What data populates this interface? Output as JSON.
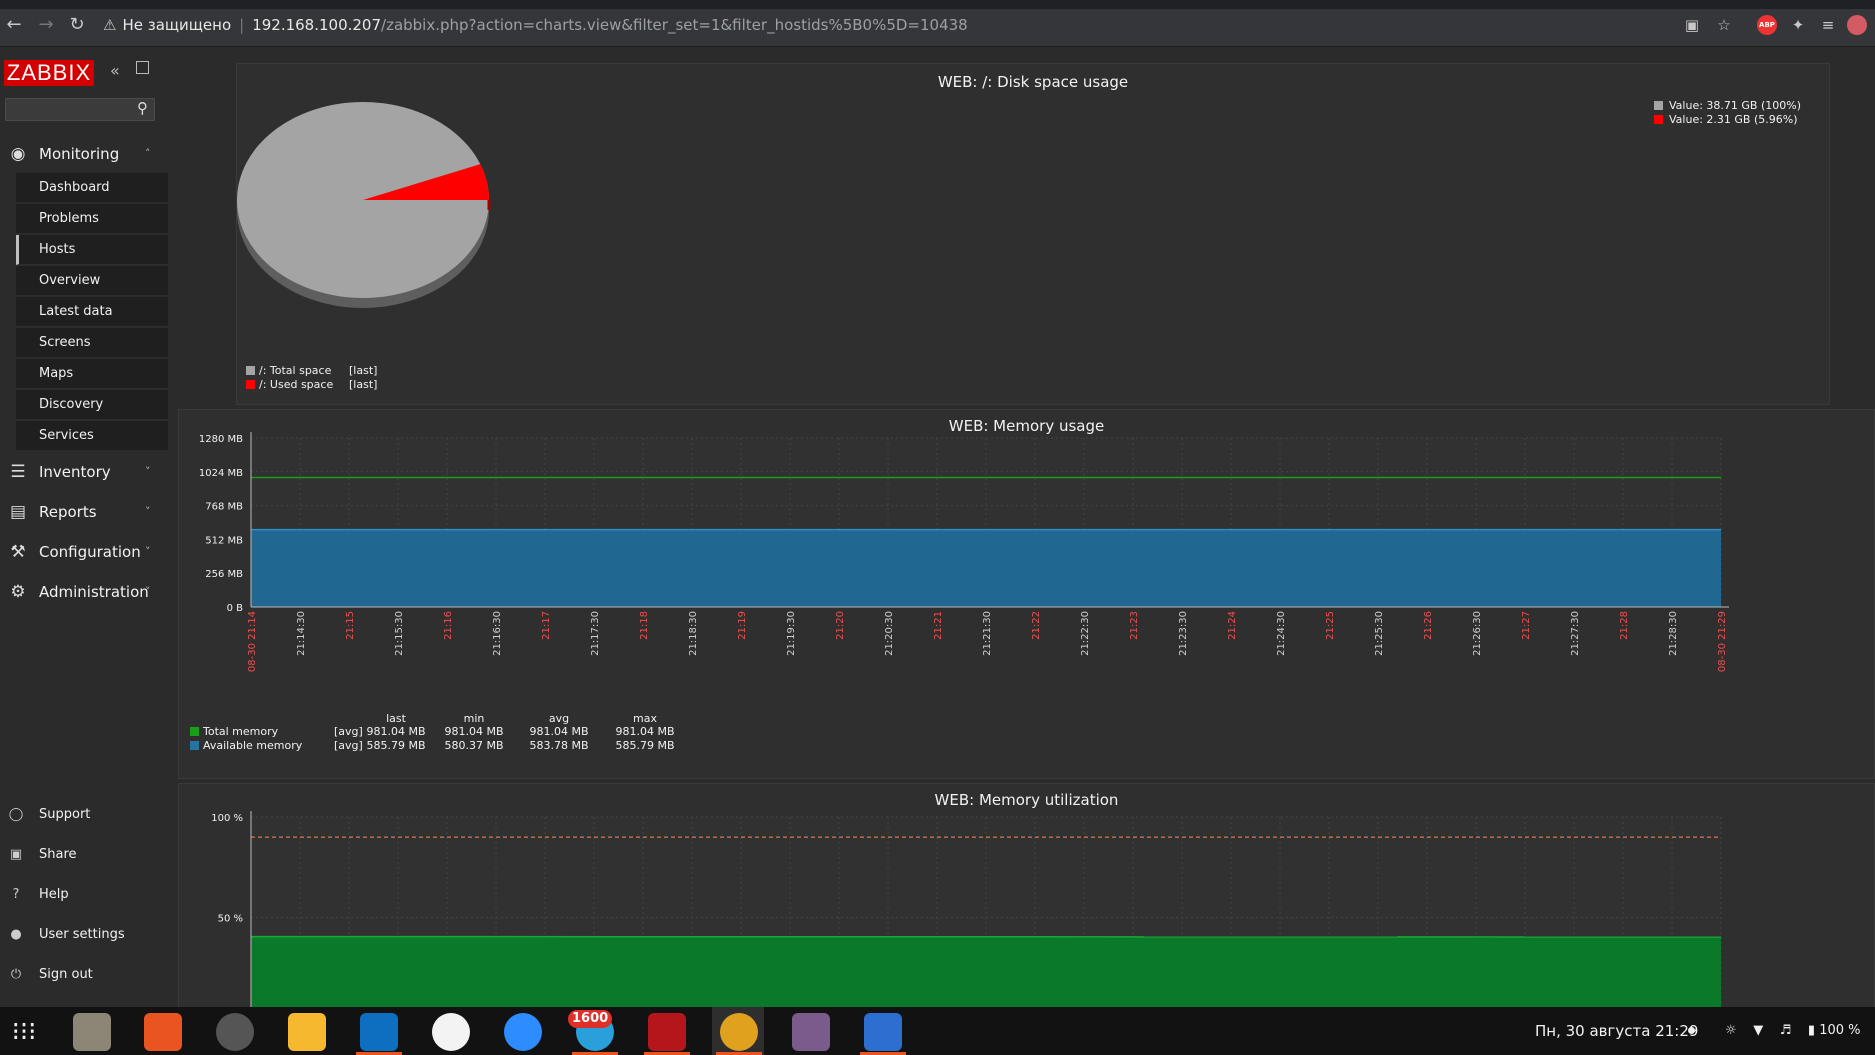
{
  "browser": {
    "security_label": "Не защищено",
    "url_host": "192.168.100.207",
    "url_path": "/zabbix.php?action=charts.view&filter_set=1&filter_hostids%5B0%5D=10438",
    "adblock_label": "ABP"
  },
  "sidebar": {
    "logo": "ZABBIX",
    "sections": [
      {
        "label": "Monitoring",
        "icon": "eye-icon",
        "expanded": true
      },
      {
        "label": "Inventory",
        "icon": "list-icon"
      },
      {
        "label": "Reports",
        "icon": "bar-chart-icon"
      },
      {
        "label": "Configuration",
        "icon": "wrench-icon"
      },
      {
        "label": "Administration",
        "icon": "gear-icon"
      }
    ],
    "monitoring_items": [
      "Dashboard",
      "Problems",
      "Hosts",
      "Overview",
      "Latest data",
      "Screens",
      "Maps",
      "Discovery",
      "Services"
    ],
    "active_item": "Hosts",
    "footer": [
      "Support",
      "Share",
      "Help",
      "User settings",
      "Sign out"
    ]
  },
  "graphs": {
    "disk": {
      "title": "WEB: /: Disk space usage",
      "values": [
        "Value: 38.71 GB (100%)",
        "Value: 2.31 GB (5.96%)"
      ],
      "items": [
        {
          "name": "/: Total space",
          "func": "[last]",
          "color": "#a4a4a4"
        },
        {
          "name": "/: Used space",
          "func": "[last]",
          "color": "#ff0000"
        }
      ]
    },
    "memory": {
      "title": "WEB: Memory usage",
      "headers": [
        "last",
        "min",
        "avg",
        "max"
      ],
      "rows": [
        {
          "name": "Total memory",
          "func": "[avg]",
          "last": "981.04 MB",
          "min": "981.04 MB",
          "avg": "981.04 MB",
          "max": "981.04 MB",
          "color": "#1a9f1a"
        },
        {
          "name": "Available memory",
          "func": "[avg]",
          "last": "585.79 MB",
          "min": "580.37 MB",
          "avg": "583.78 MB",
          "max": "585.79 MB",
          "color": "#2774a4"
        }
      ],
      "start_label": "08-30 21:14",
      "end_label": "08-30 21:29"
    },
    "util": {
      "title": "WEB: Memory utilization"
    }
  },
  "chart_data": [
    {
      "type": "pie",
      "title": "WEB: /: Disk space usage",
      "series": [
        {
          "name": "/: Total space",
          "value": 38.71,
          "unit": "GB"
        },
        {
          "name": "/: Used space",
          "value": 2.31,
          "unit": "GB",
          "percent": 5.96
        }
      ]
    },
    {
      "type": "area",
      "title": "WEB: Memory usage",
      "yticks": [
        "0 B",
        "256 MB",
        "512 MB",
        "768 MB",
        "1024 MB",
        "1280 MB"
      ],
      "ylim": [
        0,
        1280
      ],
      "xticks": [
        "21:14",
        "21:14:30",
        "21:15",
        "21:15:30",
        "21:16",
        "21:16:30",
        "21:17",
        "21:17:30",
        "21:18",
        "21:18:30",
        "21:19",
        "21:19:30",
        "21:20",
        "21:20:30",
        "21:21",
        "21:21:30",
        "21:22",
        "21:22:30",
        "21:23",
        "21:23:30",
        "21:24",
        "21:24:30",
        "21:25",
        "21:25:30",
        "21:26",
        "21:26:30",
        "21:27",
        "21:27:30",
        "21:28",
        "21:28:30",
        "21:29"
      ],
      "series": [
        {
          "name": "Total memory",
          "values": [
            981.04,
            981.04
          ]
        },
        {
          "name": "Available memory",
          "values": [
            585.79,
            585.79
          ]
        }
      ]
    },
    {
      "type": "area",
      "title": "WEB: Memory utilization",
      "yticks": [
        "50 %",
        "100 %"
      ],
      "ylim": [
        0,
        100
      ],
      "threshold": 90,
      "series": [
        {
          "name": "Memory utilization",
          "values": [
            40.5,
            40.3
          ]
        }
      ]
    }
  ],
  "taskbar": {
    "telegram_badge": "1600",
    "clock": "Пн, 30 августа  21:29",
    "battery": "100 %"
  }
}
